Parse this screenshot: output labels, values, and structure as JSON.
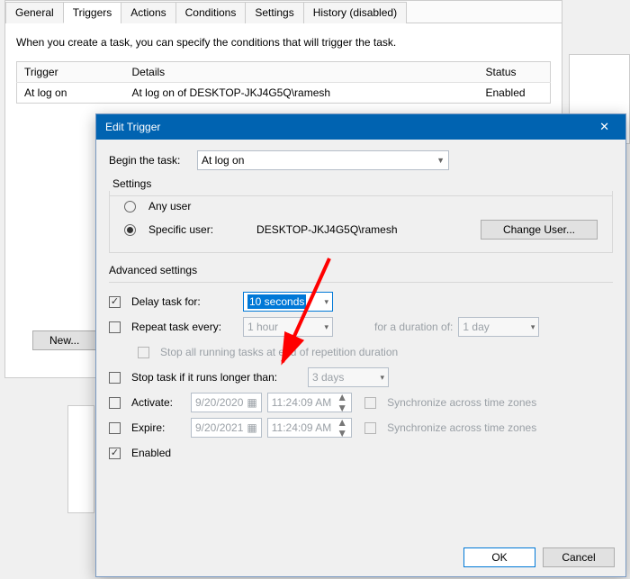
{
  "tabs": {
    "general": "General",
    "triggers": "Triggers",
    "actions": "Actions",
    "conditions": "Conditions",
    "settings": "Settings",
    "history": "History (disabled)"
  },
  "intro": "When you create a task, you can specify the conditions that will trigger the task.",
  "table": {
    "headers": {
      "trigger": "Trigger",
      "details": "Details",
      "status": "Status"
    },
    "row": {
      "trigger": "At log on",
      "details": "At log on of DESKTOP-JKJ4G5Q\\ramesh",
      "status": "Enabled"
    }
  },
  "new_btn": "New...",
  "modal": {
    "title": "Edit Trigger",
    "begin_label": "Begin the task:",
    "begin_value": "At log on",
    "settings_label": "Settings",
    "any_user": "Any user",
    "specific_user": "Specific user:",
    "user_value": "DESKTOP-JKJ4G5Q\\ramesh",
    "change_user": "Change User...",
    "adv_label": "Advanced settings",
    "delay_label": "Delay task for:",
    "delay_value": "10 seconds",
    "repeat_label": "Repeat task every:",
    "repeat_value": "1 hour",
    "duration_label": "for a duration of:",
    "duration_value": "1 day",
    "stop_all": "Stop all running tasks at end of repetition duration",
    "stop_if_label": "Stop task if it runs longer than:",
    "stop_if_value": "3 days",
    "activate_label": "Activate:",
    "activate_date": "9/20/2020",
    "activate_time": "11:24:09 AM",
    "expire_label": "Expire:",
    "expire_date": "9/20/2021",
    "expire_time": "11:24:09 AM",
    "sync_tz": "Synchronize across time zones",
    "enabled": "Enabled",
    "ok": "OK",
    "cancel": "Cancel"
  }
}
